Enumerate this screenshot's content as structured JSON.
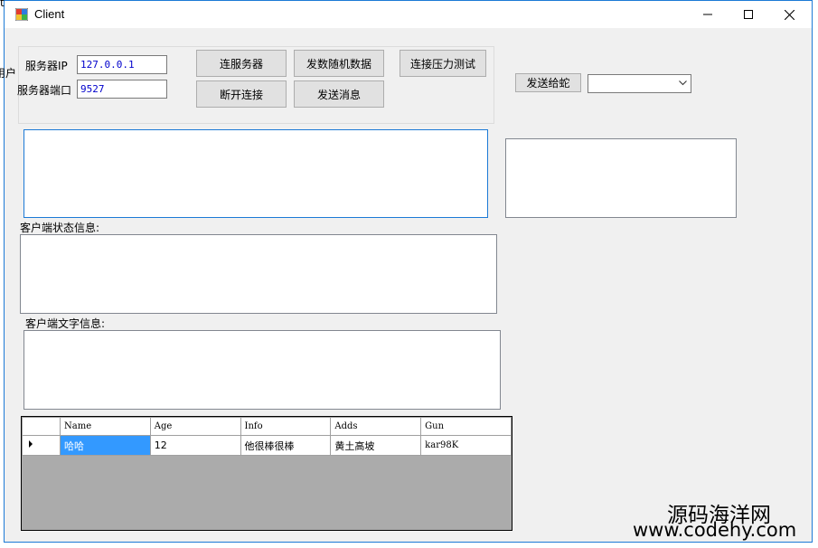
{
  "background_fragments": [
    "t",
    "用户"
  ],
  "window": {
    "title": "Client",
    "accent_color": "#1c7ad6",
    "icons": {
      "app": "app-icon",
      "minimize": "minimize-icon",
      "maximize": "maximize-icon",
      "close": "close-icon"
    }
  },
  "connection": {
    "server_ip_label": "服务器IP",
    "server_ip_value": "127.0.0.1",
    "server_port_label": "服务器端口",
    "server_port_value": "9527"
  },
  "buttons": {
    "connect": "连服务器",
    "disconnect": "断开连接",
    "send_random": "发数随机数据",
    "send_message": "发送消息",
    "stress_test": "连接压力测试",
    "send_to": "发送给蛇"
  },
  "target_select": {
    "value": ""
  },
  "labels": {
    "client_status": "客户端状态信息:",
    "client_text": "客户端文字信息:"
  },
  "grid": {
    "columns": [
      "Name",
      "Age",
      "Info",
      "Adds",
      "Gun"
    ],
    "rows": [
      {
        "cells": [
          "哈哈",
          "12",
          "他很棒很棒",
          "黄土高坡",
          "kar98K"
        ],
        "selected_col": 0,
        "current": true
      }
    ],
    "selection_color": "#3399ff",
    "empty_area_color": "#ababab"
  },
  "watermark": {
    "line1": "源码海洋网",
    "line2": "www.codehy.com"
  }
}
